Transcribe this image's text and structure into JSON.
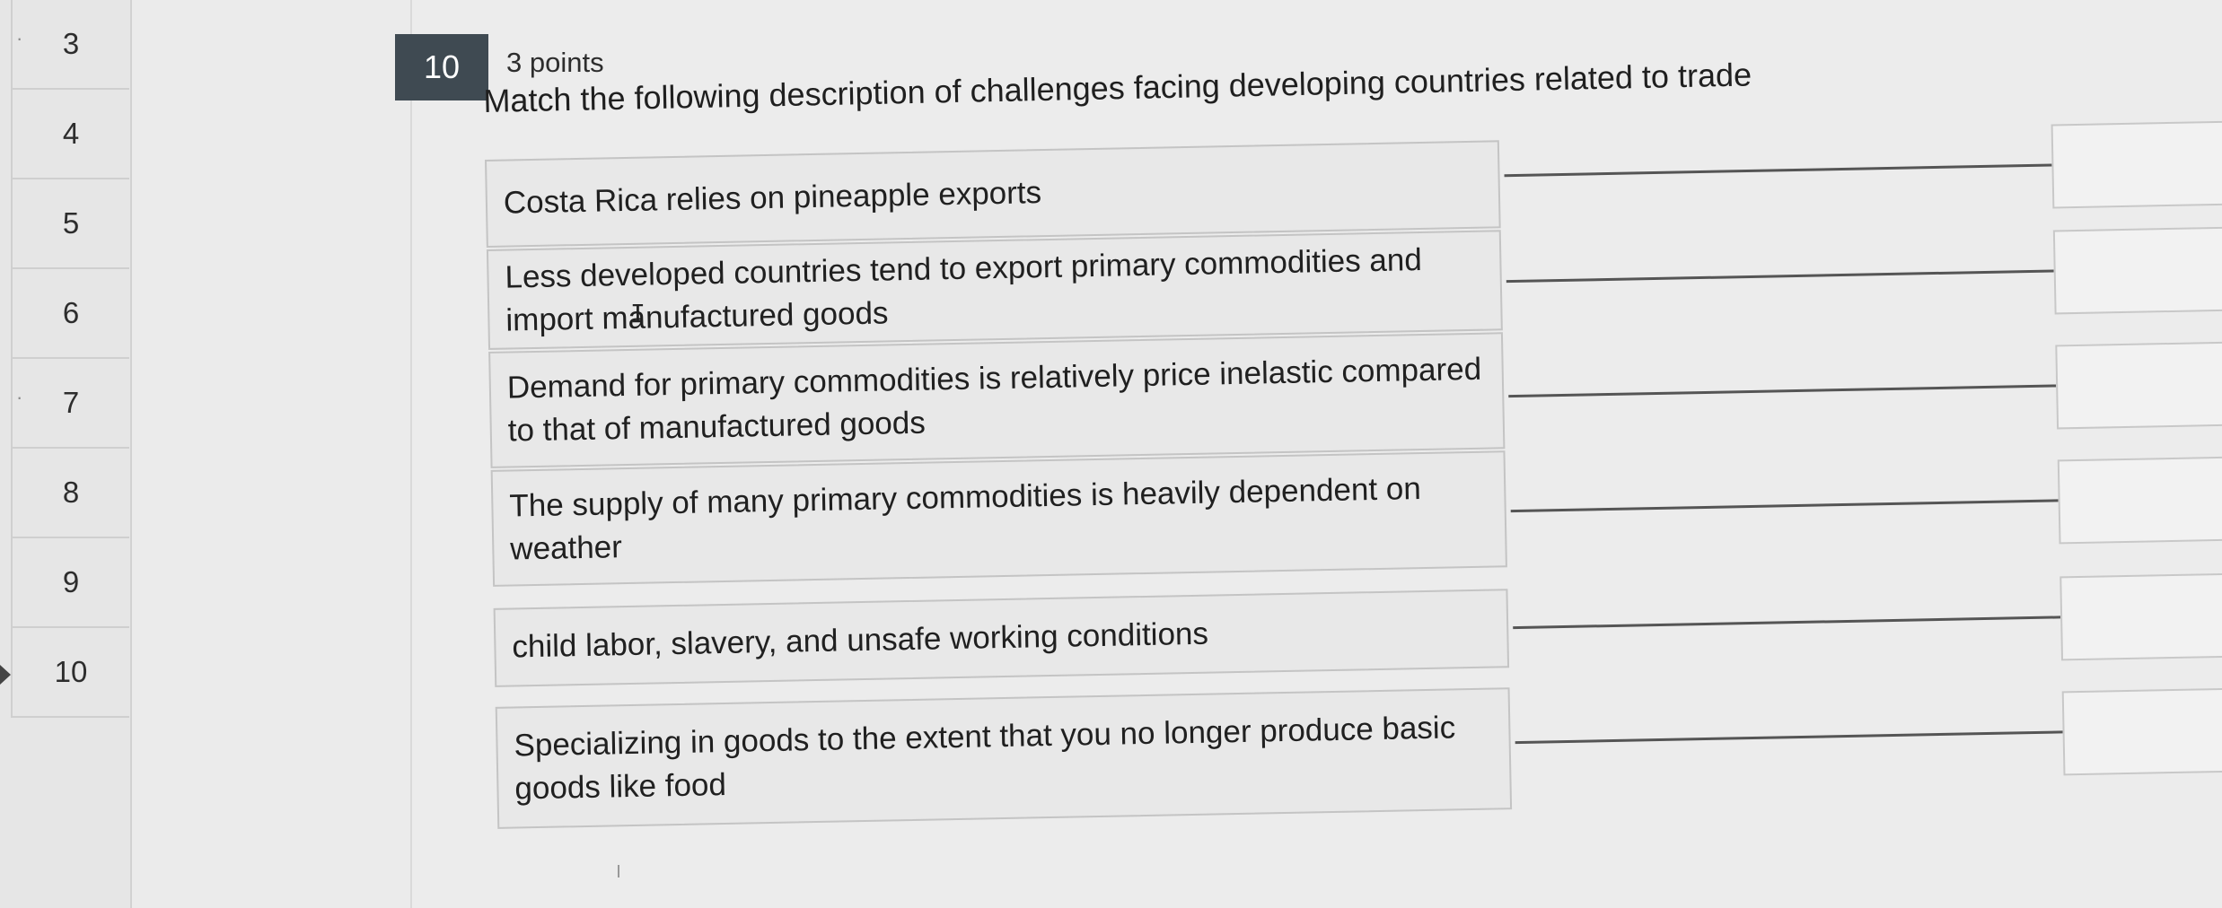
{
  "nav": {
    "items": [
      {
        "label": "3"
      },
      {
        "label": "4"
      },
      {
        "label": "5"
      },
      {
        "label": "6"
      },
      {
        "label": "7"
      },
      {
        "label": "8"
      },
      {
        "label": "9"
      },
      {
        "label": "10"
      }
    ],
    "current": "10"
  },
  "question": {
    "number": "10",
    "points": "3 points",
    "prompt": "Match the following description of challenges facing developing countries related to trade"
  },
  "matching": {
    "items": [
      {
        "text": "Costa Rica relies on pineapple exports"
      },
      {
        "text": "Less developed countries tend to export primary commodities and import manufactured goods"
      },
      {
        "text": "Demand for primary commodities is relatively price inelastic compared to that of manufactured goods"
      },
      {
        "text": "The supply of many primary commodities is heavily dependent on weather"
      },
      {
        "text": "child labor, slavery, and unsafe working conditions"
      },
      {
        "text": "Specializing in goods to the extent that you no longer produce basic goods like food"
      }
    ]
  },
  "icons": {
    "text_cursor": "text-cursor-icon",
    "current_marker": "current-question-marker-icon"
  }
}
